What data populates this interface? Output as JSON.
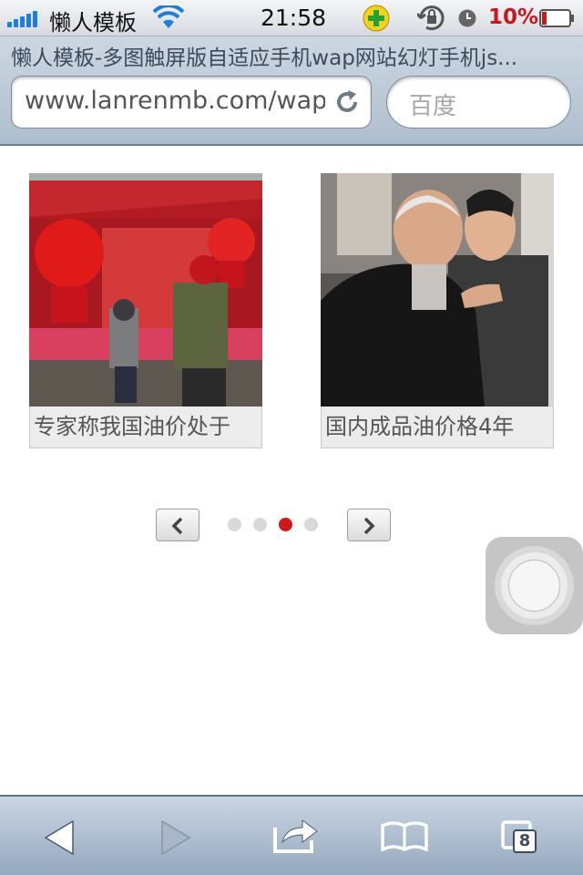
{
  "status_bar": {
    "carrier": "懒人模板",
    "time": "21:58",
    "battery": "10%",
    "colors": {
      "battery_text": "#c8181e",
      "signal": "#1f7de0"
    }
  },
  "browser": {
    "page_title": "懒人模板-多图触屏版自适应手机wap网站幻灯手机js...",
    "url": "www.lanrenmb.com/wap",
    "search_placeholder": "百度"
  },
  "slider": {
    "slides": [
      {
        "caption": "专家称我国油价处于",
        "image": "lanterns-market-photo"
      },
      {
        "caption": "国内成品油价格4年",
        "image": "men-in-suits-photo"
      }
    ],
    "pagination": {
      "total": 4,
      "active_index": 2
    },
    "active_dot_color": "#d01818",
    "prev_icon": "chevron-left-icon",
    "next_icon": "chevron-right-icon"
  },
  "toolbar": {
    "tabs_count": "8",
    "icons": [
      "back-arrow-icon",
      "forward-arrow-icon",
      "share-icon",
      "bookmarks-icon",
      "tabs-icon"
    ]
  }
}
